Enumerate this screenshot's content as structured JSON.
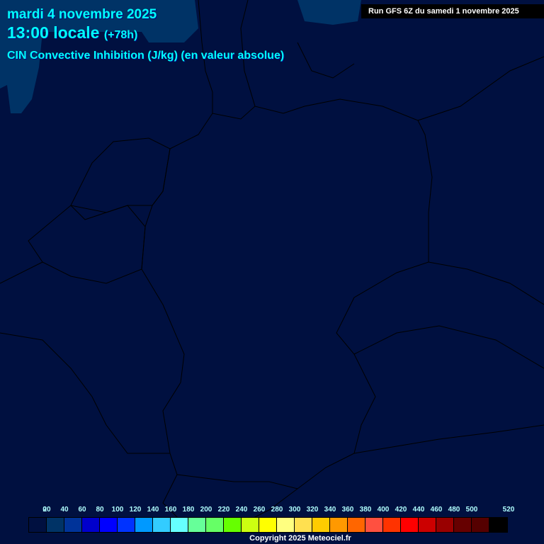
{
  "header": {
    "date": "mardi 4 novembre 2025",
    "time": "13:00 locale",
    "lead": "(+78h)",
    "parameter": "CIN Convective Inhibition (J/kg) (en valeur absolue)",
    "run": "Run GFS 6Z du samedi 1 novembre 2025"
  },
  "legend": {
    "labels": [
      "0",
      "20",
      "40",
      "60",
      "80",
      "100",
      "120",
      "140",
      "160",
      "180",
      "200",
      "220",
      "240",
      "260",
      "280",
      "300",
      "320",
      "340",
      "360",
      "380",
      "400",
      "420",
      "440",
      "460",
      "480",
      "500",
      "520"
    ],
    "colors": [
      "#001040",
      "#003366",
      "#003399",
      "#0000cc",
      "#0000ff",
      "#0033ff",
      "#0099ff",
      "#33ccff",
      "#66ffff",
      "#66ff99",
      "#66ff66",
      "#66ff00",
      "#ccff11",
      "#ffff00",
      "#ffff80",
      "#ffe050",
      "#ffcc00",
      "#ff9900",
      "#ff6600",
      "#ff5040",
      "#ff3300",
      "#ff0000",
      "#cc0000",
      "#990000",
      "#660000",
      "#550000",
      "#000000"
    ]
  },
  "copyright": "Copyright 2025 Meteociel.fr"
}
